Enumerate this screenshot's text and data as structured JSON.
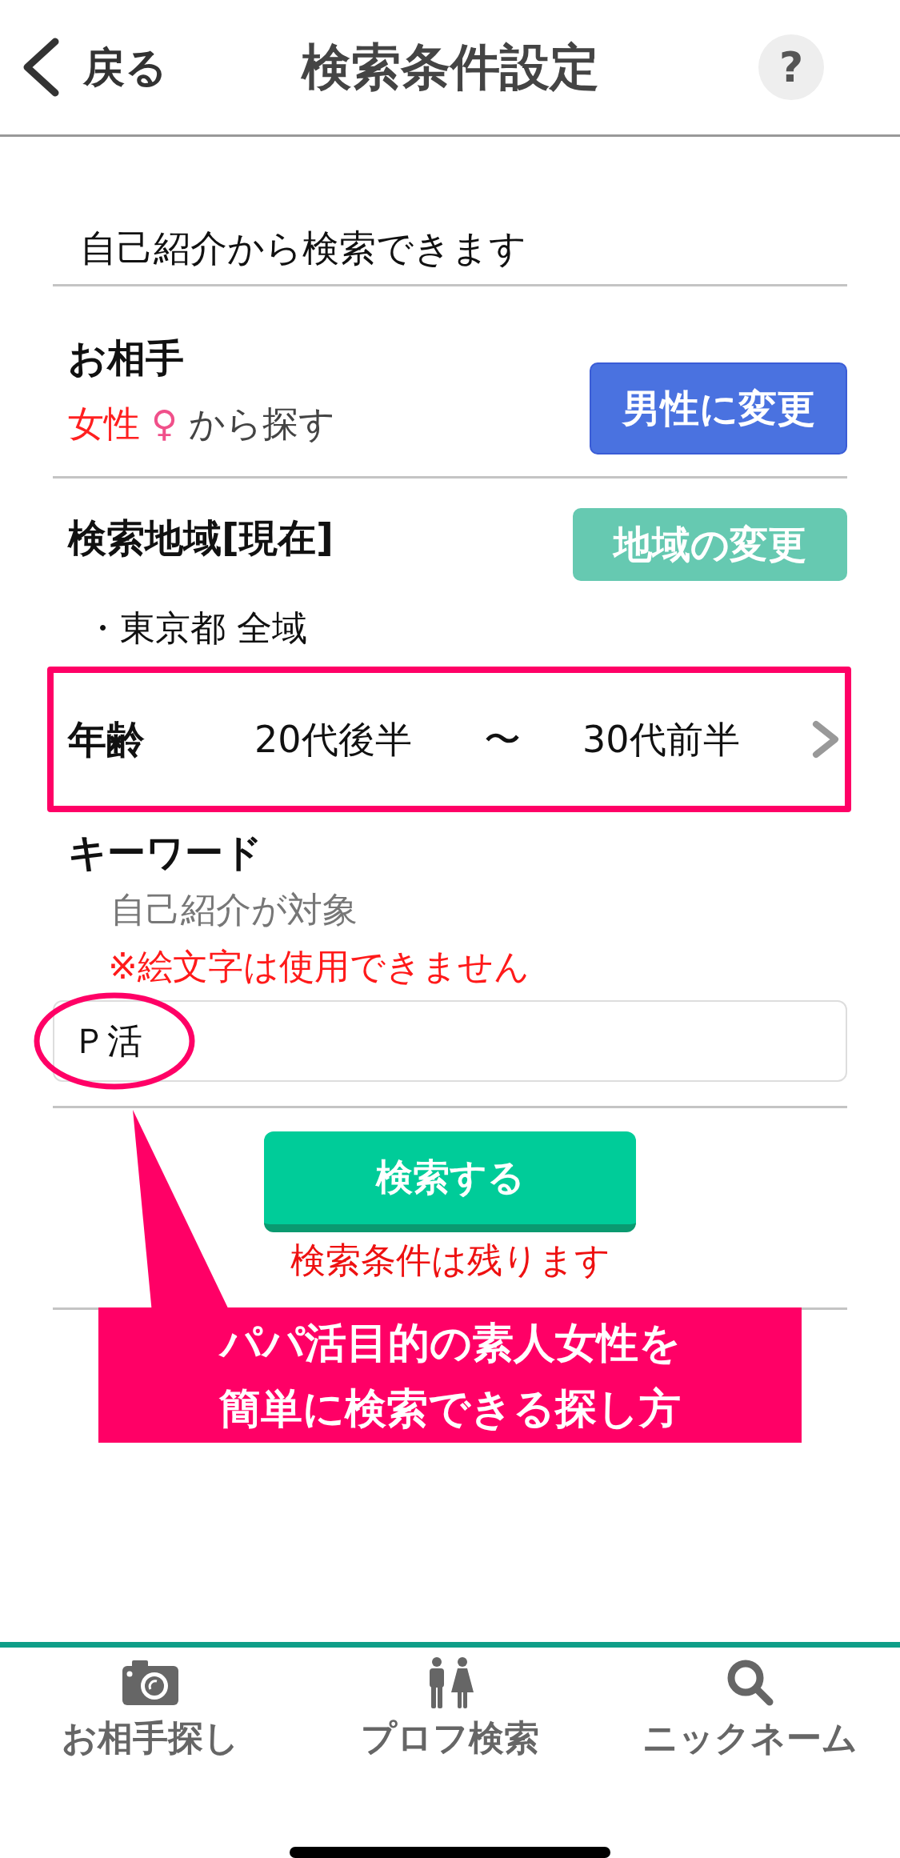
{
  "header": {
    "back_label": "戻る",
    "title": "検索条件設定",
    "help_label": "?"
  },
  "intro": "自己紹介から検索できます",
  "partner": {
    "heading": "お相手",
    "gender": "女性",
    "gender_symbol": "♀",
    "suffix": "から探す",
    "button": "男性に変更"
  },
  "area": {
    "heading": "検索地域[現在]",
    "button": "地域の変更",
    "items": [
      "・東京都 全域"
    ]
  },
  "age": {
    "label": "年齢",
    "from": "20代後半",
    "separator": "〜",
    "to": "30代前半"
  },
  "keyword": {
    "heading": "キーワード",
    "note": "自己紹介が対象",
    "warning": "※絵文字は使用できません",
    "value": "Ｐ活"
  },
  "search": {
    "button": "検索する",
    "note": "検索条件は残ります"
  },
  "callout": {
    "lines": [
      "パパ活目的の素人女性を",
      "簡単に検索できる探し方"
    ]
  },
  "bottom_nav": [
    {
      "label": "お相手探し"
    },
    {
      "label": "プロフ検索"
    },
    {
      "label": "ニックネーム"
    }
  ]
}
